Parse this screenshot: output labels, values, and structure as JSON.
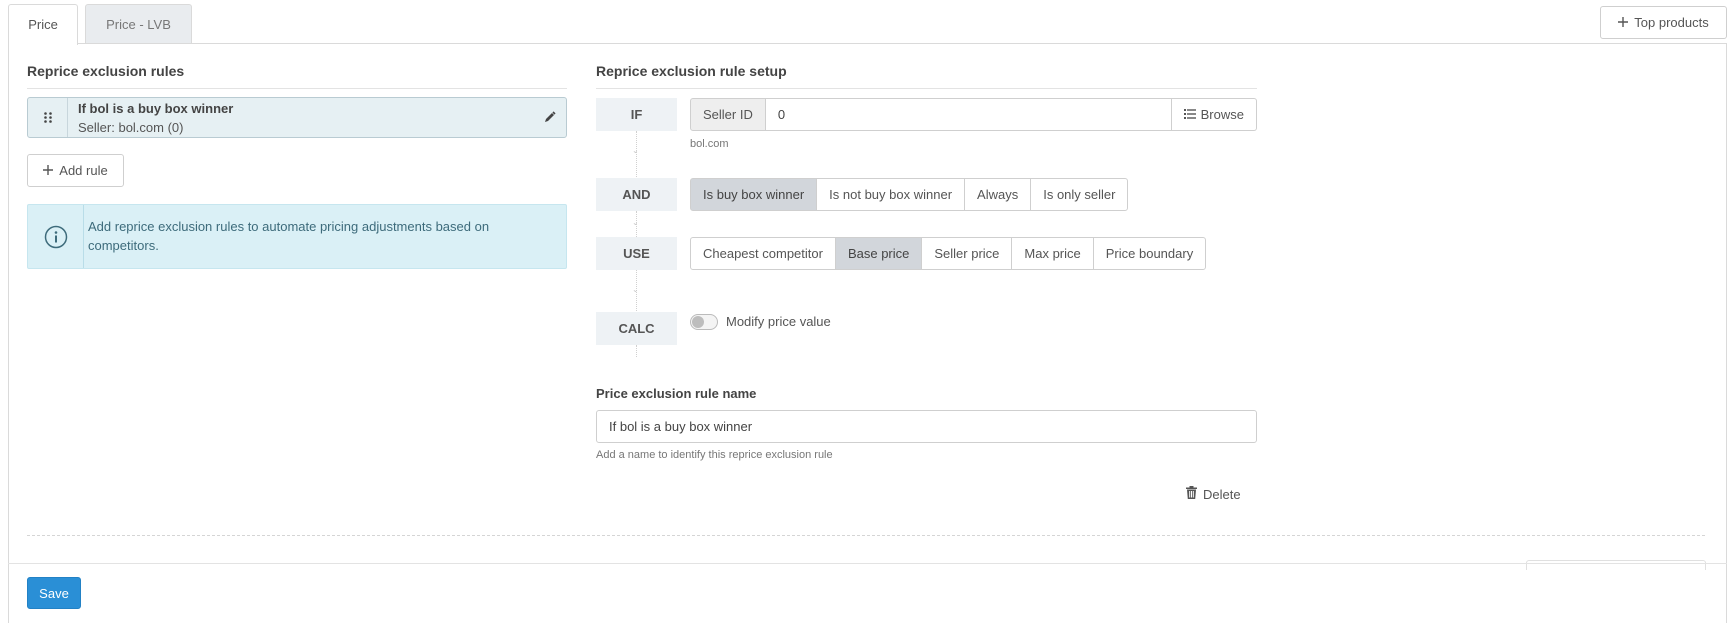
{
  "tabs": [
    {
      "label": "Price",
      "active": true
    },
    {
      "label": "Price - LVB",
      "active": false
    }
  ],
  "top_products_label": "Top products",
  "left": {
    "title": "Reprice exclusion rules",
    "rule": {
      "title": "If bol is a buy box winner",
      "subtitle": "Seller: bol.com (0)"
    },
    "add_rule_label": "Add rule",
    "info_text": "Add reprice exclusion rules to automate pricing adjustments based on competitors."
  },
  "right": {
    "title": "Reprice exclusion rule setup",
    "steps": {
      "if": "IF",
      "and": "AND",
      "use": "USE",
      "calc": "CALC"
    },
    "seller": {
      "addon": "Seller ID",
      "value": "0",
      "browse_label": "Browse",
      "hint": "bol.com"
    },
    "and_options": [
      {
        "label": "Is buy box winner",
        "active": true
      },
      {
        "label": "Is not buy box winner",
        "active": false
      },
      {
        "label": "Always",
        "active": false
      },
      {
        "label": "Is only seller",
        "active": false
      }
    ],
    "use_options": [
      {
        "label": "Cheapest competitor",
        "active": false
      },
      {
        "label": "Base price",
        "active": true
      },
      {
        "label": "Seller price",
        "active": false
      },
      {
        "label": "Max price",
        "active": false
      },
      {
        "label": "Price boundary",
        "active": false
      }
    ],
    "calc_toggle_label": "Modify price value",
    "calc_toggle_on": false,
    "name_label": "Price exclusion rule name",
    "name_value": "If bol is a buy box winner",
    "name_hint": "Add a name to identify this reprice exclusion rule",
    "delete_label": "Delete"
  },
  "save_label": "Save",
  "colors": {
    "primary": "#2a8fd6",
    "info_bg": "#daf0f6",
    "active_seg": "#d2d6db"
  }
}
